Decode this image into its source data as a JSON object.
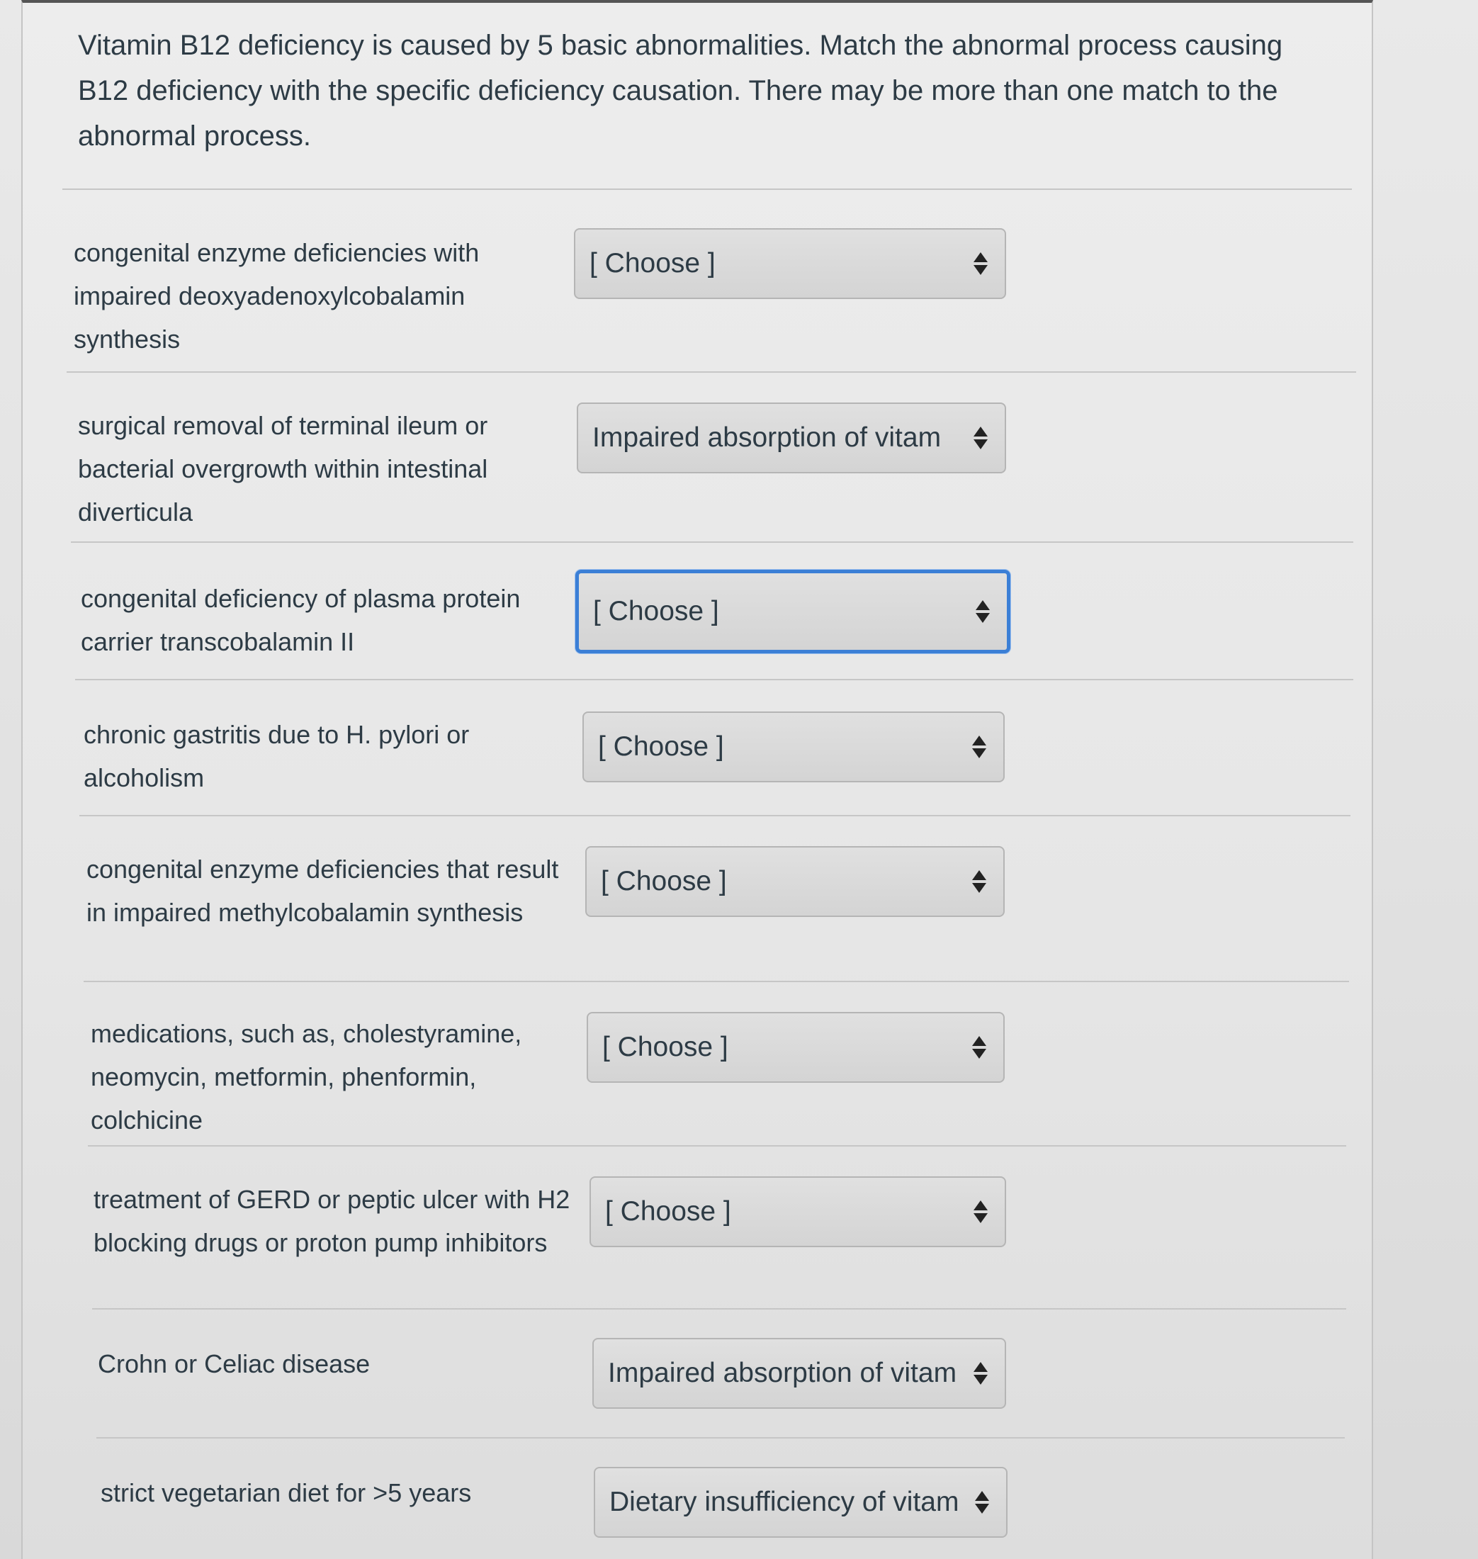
{
  "question": {
    "prompt": "Vitamin B12 deficiency is caused by 5 basic abnormalities. Match the abnormal process causing B12 deficiency with the specific deficiency causation. There may be more than one match to the abnormal process."
  },
  "matches": [
    {
      "label": "congenital enzyme deficiencies with impaired deoxyadenoxylcobalamin synthesis",
      "selected": "[ Choose ]"
    },
    {
      "label": "surgical removal of terminal ileum or bacterial overgrowth within intestinal diverticula",
      "selected": "Impaired absorption of vitam"
    },
    {
      "label": "congenital deficiency of plasma protein carrier transcobalamin II",
      "selected": "[ Choose ]"
    },
    {
      "label": "chronic gastritis due to H. pylori or alcoholism",
      "selected": "[ Choose ]"
    },
    {
      "label": "congenital enzyme deficiencies that result in impaired methylcobalamin synthesis",
      "selected": "[ Choose ]"
    },
    {
      "label": "medications, such as, cholestyramine, neomycin, metformin, phenformin, colchicine",
      "selected": "[ Choose ]"
    },
    {
      "label": "treatment of GERD or peptic ulcer with H2 blocking drugs or proton pump inhibitors",
      "selected": "[ Choose ]"
    },
    {
      "label": "Crohn or Celiac disease",
      "selected": "Impaired absorption of vitam"
    },
    {
      "label": "strict vegetarian diet for >5 years",
      "selected": "Dietary insufficiency of vitam"
    }
  ],
  "colors": {
    "focus_border": "#3b7fd6",
    "text": "#2d3b45"
  }
}
